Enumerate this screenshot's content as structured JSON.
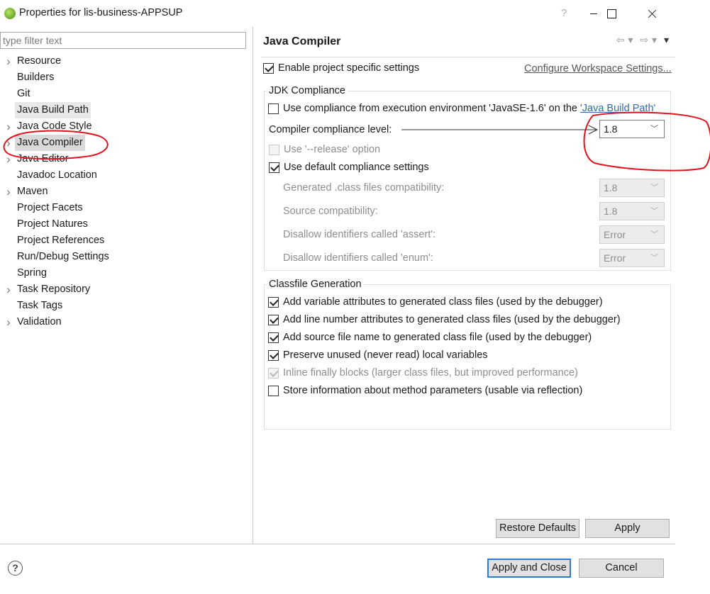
{
  "window": {
    "title": "Properties for lis-business-APPSUP",
    "help_glyph": "?"
  },
  "filter": {
    "placeholder": "type filter text",
    "value": ""
  },
  "tree": [
    {
      "label": "Resource",
      "expandable": true
    },
    {
      "label": "Builders",
      "expandable": false
    },
    {
      "label": "Git",
      "expandable": false
    },
    {
      "label": "Java Build Path",
      "expandable": false
    },
    {
      "label": "Java Code Style",
      "expandable": true
    },
    {
      "label": "Java Compiler",
      "expandable": true,
      "selected": true
    },
    {
      "label": "Java Editor",
      "expandable": true
    },
    {
      "label": "Javadoc Location",
      "expandable": false
    },
    {
      "label": "Maven",
      "expandable": true
    },
    {
      "label": "Project Facets",
      "expandable": false
    },
    {
      "label": "Project Natures",
      "expandable": false
    },
    {
      "label": "Project References",
      "expandable": false
    },
    {
      "label": "Run/Debug Settings",
      "expandable": false
    },
    {
      "label": "Spring",
      "expandable": false
    },
    {
      "label": "Task Repository",
      "expandable": true
    },
    {
      "label": "Task Tags",
      "expandable": false
    },
    {
      "label": "Validation",
      "expandable": true
    }
  ],
  "page": {
    "title": "Java Compiler",
    "enable_specific": {
      "label": "Enable project specific settings",
      "checked": true
    },
    "configure_link": "Configure Workspace Settings...",
    "jdk": {
      "title": "JDK Compliance",
      "use_env": {
        "label_prefix": "Use compliance from execution environment 'JavaSE-1.6' on the ",
        "link": "'Java Build Path'",
        "checked": false
      },
      "compliance_label": "Compiler compliance level:",
      "compliance_value": "1.8",
      "release": {
        "label": "Use '--release' option",
        "checked": false,
        "enabled": false
      },
      "use_default": {
        "label": "Use default compliance settings",
        "checked": true
      },
      "generated_label": "Generated .class files compatibility:",
      "generated_value": "1.8",
      "source_label": "Source compatibility:",
      "source_value": "1.8",
      "assert_label": "Disallow identifiers called 'assert':",
      "assert_value": "Error",
      "enum_label": "Disallow identifiers called 'enum':",
      "enum_value": "Error"
    },
    "classfile": {
      "title": "Classfile Generation",
      "items": [
        {
          "label": "Add variable attributes to generated class files (used by the debugger)",
          "checked": true,
          "enabled": true
        },
        {
          "label": "Add line number attributes to generated class files (used by the debugger)",
          "checked": true,
          "enabled": true
        },
        {
          "label": "Add source file name to generated class file (used by the debugger)",
          "checked": true,
          "enabled": true
        },
        {
          "label": "Preserve unused (never read) local variables",
          "checked": true,
          "enabled": true
        },
        {
          "label": "Inline finally blocks (larger class files, but improved performance)",
          "checked": true,
          "enabled": false
        },
        {
          "label": "Store information about method parameters (usable via reflection)",
          "checked": false,
          "enabled": true
        }
      ]
    },
    "restore_defaults": "Restore Defaults",
    "apply": "Apply"
  },
  "footer": {
    "apply_close": "Apply and Close",
    "cancel": "Cancel"
  },
  "annotation_color": "#e0141e"
}
